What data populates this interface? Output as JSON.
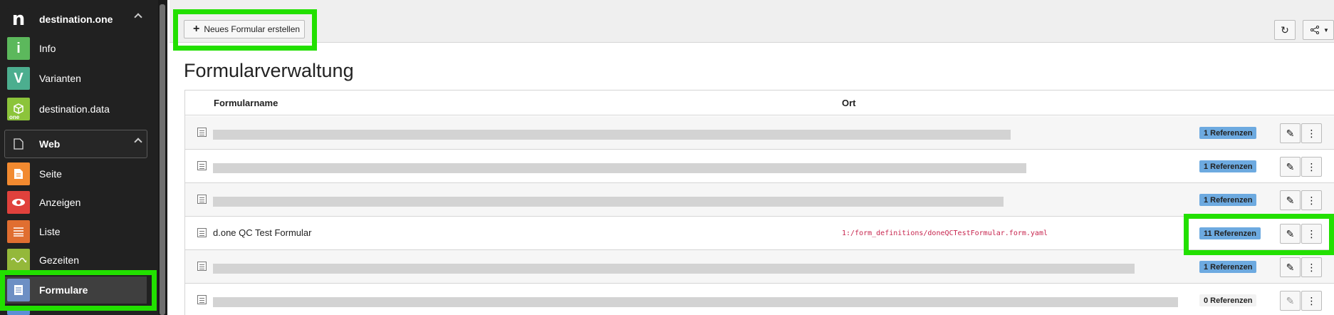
{
  "sidebar": {
    "brand": {
      "icon": "n",
      "label": "destination.one"
    },
    "modules": [
      {
        "icon": "i",
        "icon_color": "#5cb85c",
        "label": "Info"
      },
      {
        "icon": "V",
        "icon_color": "#4cae8f",
        "label": "Varianten"
      },
      {
        "icon": "cube-icon",
        "icon_color": "#8cc43b",
        "icon_tag": "one",
        "label": "destination.data"
      }
    ],
    "web_group": {
      "label": "Web"
    },
    "web_items": [
      {
        "label": "Seite",
        "icon": "page-icon",
        "icon_color": "#f28a30"
      },
      {
        "label": "Anzeigen",
        "icon": "eye-icon",
        "icon_color": "#e0413c"
      },
      {
        "label": "Liste",
        "icon": "list-icon",
        "icon_color": "#e06e30"
      },
      {
        "label": "Gezeiten",
        "icon": "wave-icon",
        "icon_color": "#94b83a"
      },
      {
        "label": "Formulare",
        "icon": "form-icon",
        "icon_color": "#6d8fc4"
      }
    ]
  },
  "toolbar": {
    "new_form_label": "Neues Formular erstellen",
    "refresh_icon": "refresh-icon",
    "share_icon": "share-icon"
  },
  "page": {
    "title": "Formularverwaltung"
  },
  "table": {
    "columns": [
      "Formularname",
      "Ort"
    ],
    "rows": [
      {
        "name": "",
        "path": "",
        "references": "1 Referenzen",
        "badge": "blue",
        "blurred": true
      },
      {
        "name": "",
        "path": "",
        "references": "1 Referenzen",
        "badge": "blue",
        "blurred": true
      },
      {
        "name": "",
        "path": "",
        "references": "1 Referenzen",
        "badge": "blue",
        "blurred": true
      },
      {
        "name": "d.one QC Test Formular",
        "path": "1:/form_definitions/doneQCTestFormular.form.yaml",
        "references": "11 Referenzen",
        "badge": "blue",
        "blurred": false
      },
      {
        "name": "",
        "path": "",
        "references": "1 Referenzen",
        "badge": "blue",
        "blurred": true
      },
      {
        "name": "",
        "path": "",
        "references": "0 Referenzen",
        "badge": "grey",
        "blurred": true
      }
    ]
  },
  "colors": {
    "highlight": "#22e000",
    "badge_blue": "#6daae0"
  }
}
